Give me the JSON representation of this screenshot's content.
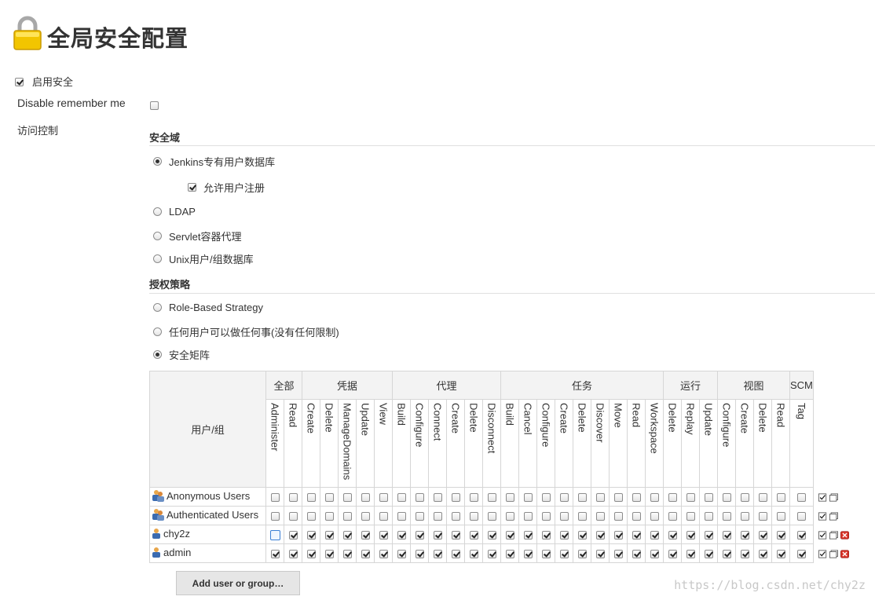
{
  "page": {
    "title": "全局安全配置",
    "enable_security": {
      "label": "启用安全",
      "checked": true
    },
    "disable_remember_me": {
      "label": "Disable remember me",
      "checked": false
    },
    "access_control_label": "访问控制"
  },
  "security_realm": {
    "heading": "安全域",
    "options": [
      {
        "label": "Jenkins专有用户数据库",
        "selected": true
      },
      {
        "label": "LDAP",
        "selected": false
      },
      {
        "label": "Servlet容器代理",
        "selected": false
      },
      {
        "label": "Unix用户/组数据库",
        "selected": false
      }
    ],
    "allow_signup": {
      "label": "允许用户注册",
      "checked": true
    }
  },
  "authorization": {
    "heading": "授权策略",
    "options": [
      {
        "label": "Role-Based Strategy",
        "selected": false
      },
      {
        "label": "任何用户可以做任何事(没有任何限制)",
        "selected": false
      },
      {
        "label": "安全矩阵",
        "selected": true
      }
    ]
  },
  "matrix": {
    "user_col_header": "用户/组",
    "groups": [
      {
        "name": "全部",
        "perms": [
          "Administer",
          "Read"
        ]
      },
      {
        "name": "凭据",
        "perms": [
          "Create",
          "Delete",
          "ManageDomains",
          "Update",
          "View"
        ]
      },
      {
        "name": "代理",
        "perms": [
          "Build",
          "Configure",
          "Connect",
          "Create",
          "Delete",
          "Disconnect"
        ]
      },
      {
        "name": "任务",
        "perms": [
          "Build",
          "Cancel",
          "Configure",
          "Create",
          "Delete",
          "Discover",
          "Move",
          "Read",
          "Workspace"
        ]
      },
      {
        "name": "运行",
        "perms": [
          "Delete",
          "Replay",
          "Update"
        ]
      },
      {
        "name": "视图",
        "perms": [
          "Configure",
          "Create",
          "Delete",
          "Read"
        ]
      },
      {
        "name": "SCM",
        "perms": [
          "Tag"
        ]
      }
    ],
    "rows": [
      {
        "name": "Anonymous Users",
        "kind": "group",
        "all_checked": false,
        "removable": false
      },
      {
        "name": "Authenticated Users",
        "kind": "group",
        "all_checked": false,
        "removable": false
      },
      {
        "name": "chy2z",
        "kind": "user",
        "all_checked": true,
        "first_unchecked": true,
        "removable": true
      },
      {
        "name": "admin",
        "kind": "user",
        "all_checked": true,
        "removable": true
      }
    ],
    "add_button": "Add user or group…"
  },
  "watermark": "https://blog.csdn.net/chy2z"
}
